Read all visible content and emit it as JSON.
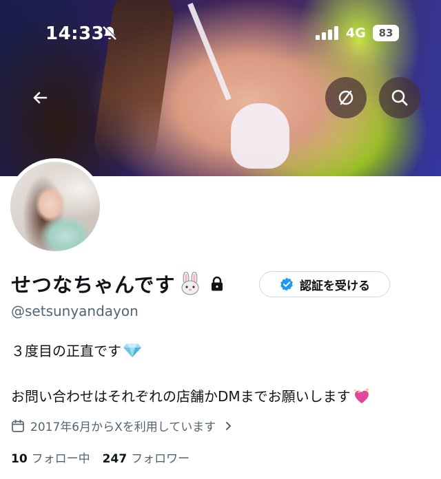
{
  "status_bar": {
    "time": "14:33",
    "network": "4G",
    "battery": "83"
  },
  "header": {
    "icons": [
      "back-arrow-icon",
      "block-icon",
      "search-icon"
    ]
  },
  "profile": {
    "display_name": "せつなちゃんです",
    "name_emoji": "rabbit-face-icon",
    "verify_button_label": "認証を受ける",
    "handle": "@setsunyandayon",
    "bio_line1": "３度目の正直です",
    "bio_line2": "お問い合わせはそれぞれの店舗かDMまでお願いします",
    "joined": "2017年6月からXを利用しています",
    "following_count": "10",
    "following_label": "フォロー中",
    "followers_count": "247",
    "followers_label": "フォロワー"
  },
  "colors": {
    "text_primary": "#0f1419",
    "text_secondary": "#536471",
    "verified_blue": "#1d9bf0",
    "border": "#cfd9de"
  }
}
